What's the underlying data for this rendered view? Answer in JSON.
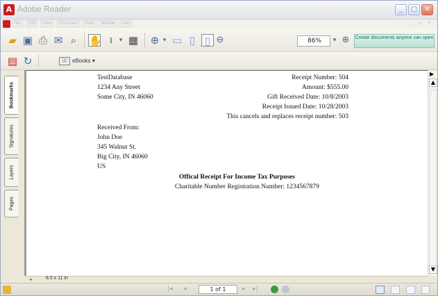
{
  "window": {
    "title": "Adobe Reader"
  },
  "menu": {
    "items": [
      "File",
      "Edit",
      "View",
      "Document",
      "Tools",
      "Window",
      "Help"
    ]
  },
  "toolbar": {
    "zoom_value": "86%",
    "promo_text": "Create documents anyone can open",
    "icons": [
      "open-icon",
      "save-icon",
      "print-icon",
      "email-icon",
      "search-icon",
      "hand-tool-icon",
      "select-text-icon",
      "snapshot-icon",
      "zoom-in-tool-icon",
      "actual-size-icon",
      "fit-page-icon",
      "fit-width-icon",
      "zoom-out-icon",
      "zoom-in-icon"
    ]
  },
  "toolbar2": {
    "ebooks_label": "eBooks"
  },
  "nav_tabs": [
    "Bookmarks",
    "Signatures",
    "Layers",
    "Pages"
  ],
  "document": {
    "org_name": "TestDatabase",
    "org_street": "1234 Any Street",
    "org_city": "Some City, IN 46060",
    "receipt_number": "Receipt Number: 504",
    "amount": "Amount: $555.00",
    "gift_date": "Gift Received Date: 10/8/2003",
    "issued_date": "Receipt Issued Date: 10/28/2003",
    "replaces": "This cancels and replaces receipt number: 503",
    "received_from_label": "Received From:",
    "donor_name": "John Doe",
    "donor_street": "345 Walnut St.",
    "donor_city": "Big City, IN 46060",
    "donor_country": "US",
    "receipt_title": "Offical Receipt For Income Tax Purposes",
    "registration": "Charitable Number Registration Number: 1234567879"
  },
  "status": {
    "page_size": "8.5 x 11 in",
    "page_indicator": "1 of 1"
  }
}
